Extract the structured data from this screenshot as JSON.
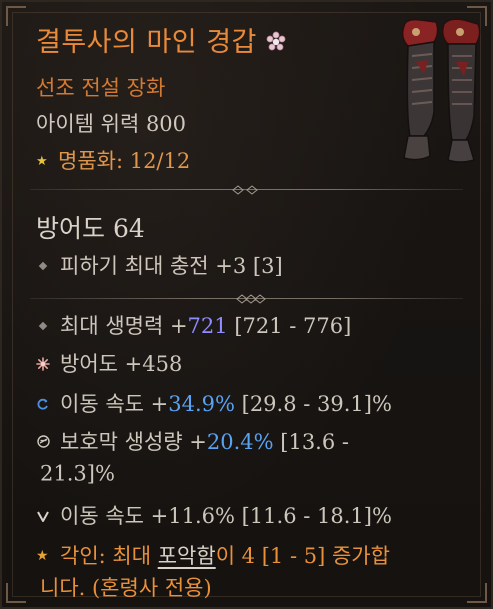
{
  "item": {
    "name": "결투사의 마인 경갑",
    "type": "선조 전설 장화",
    "power": "아이템 위력 800",
    "masterwork": "명품화: 12/12"
  },
  "armor": "방어도 64",
  "implicit": {
    "text": "피하기 최대 충전 +3 [3]"
  },
  "affixes": [
    {
      "prefix": "최대 생명력 +",
      "value": "721",
      "suffix": " [721 - 776]"
    },
    {
      "prefix": "방어도 +458",
      "value": "",
      "suffix": ""
    },
    {
      "prefix": "이동 속도 +",
      "value": "34.9%",
      "suffix": " [29.8 - 39.1]%"
    },
    {
      "prefix": "보호막 생성량 +",
      "value": "20.4%",
      "suffix": " [13.6 -",
      "line2": "21.3]%"
    },
    {
      "prefix": "이동 속도 +11.6% [11.6 - 18.1]%",
      "value": "",
      "suffix": ""
    }
  ],
  "aspect": {
    "label": "각인: 최대 ",
    "underlined": "포악함",
    "mid": "이 4 [1 - 5] ",
    "highlight1": "증가합",
    "line2": "니다. (혼령사 전용)"
  },
  "colors": {
    "legendary": "#e98a3a",
    "greater_affix": "#8f8cff",
    "tempered": "#5aa2f2",
    "star": "#e8c23a"
  },
  "icons": {
    "title_mark": "ancestral-flower-icon",
    "masterwork": "star-icon",
    "implicit": "diamond-icon",
    "affix_normal": "diamond-icon",
    "affix_greater": "greater-affix-icon",
    "affix_tempered": "tempered-icon",
    "affix_shield": "shield-rune-icon",
    "affix_socket": "v-rune-icon",
    "aspect": "star-icon"
  }
}
